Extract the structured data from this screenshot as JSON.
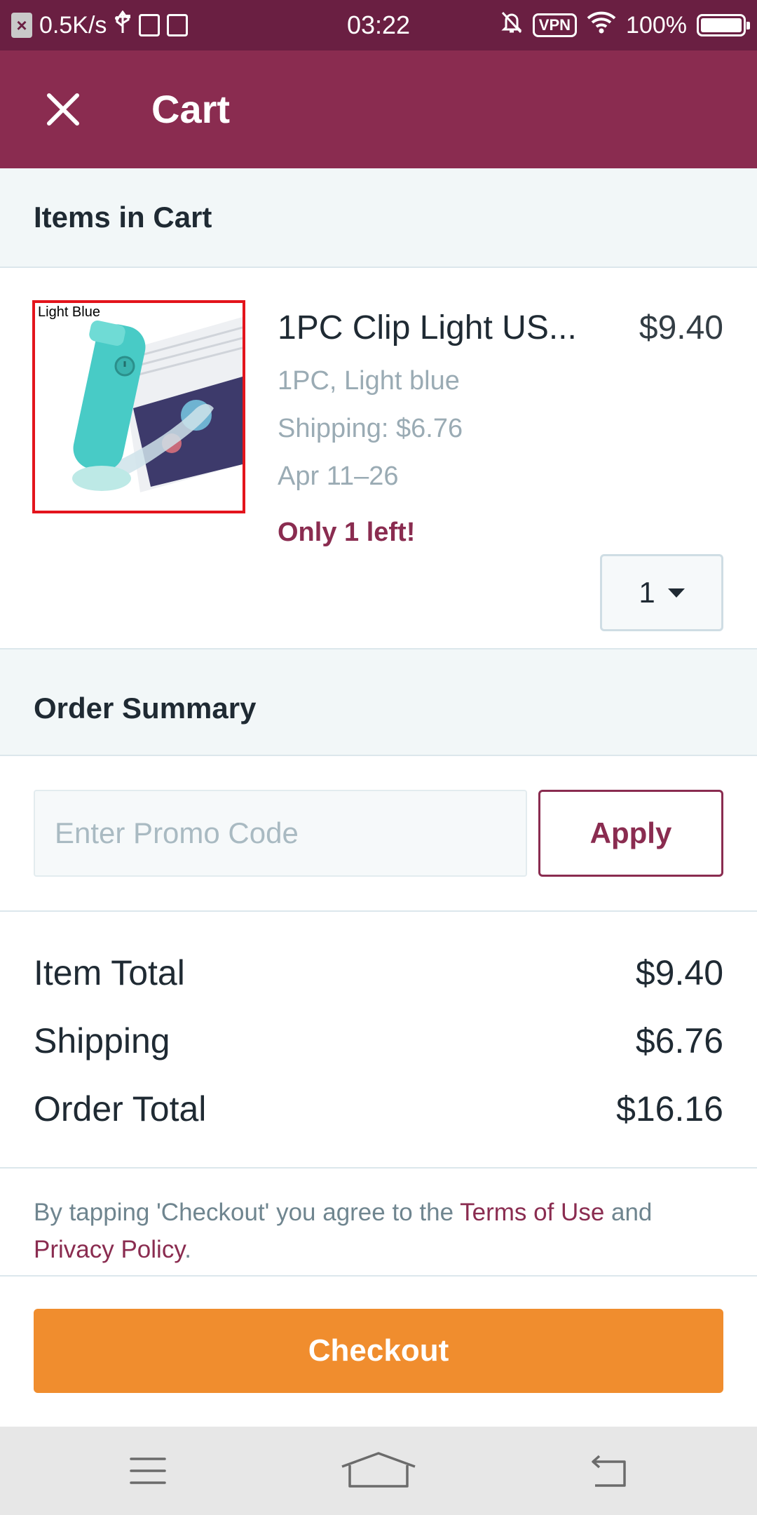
{
  "status_bar": {
    "speed": "0.5K/s",
    "time": "03:22",
    "vpn": "VPN",
    "battery": "100%"
  },
  "app_bar": {
    "title": "Cart"
  },
  "items_section": {
    "title": "Items in Cart"
  },
  "item": {
    "image_label": "Light Blue",
    "name": "1PC Clip Light US...",
    "price": "$9.40",
    "variant": "1PC, Light blue",
    "shipping": "Shipping: $6.76",
    "delivery": "Apr 11–26",
    "stock": "Only 1 left!",
    "quantity": "1"
  },
  "summary_section": {
    "title": "Order Summary"
  },
  "promo": {
    "placeholder": "Enter Promo Code",
    "apply_label": "Apply"
  },
  "totals": [
    {
      "label": "Item Total",
      "value": "$9.40"
    },
    {
      "label": "Shipping",
      "value": "$6.76"
    },
    {
      "label": "Order Total",
      "value": "$16.16"
    }
  ],
  "terms": {
    "prefix": "By tapping 'Checkout' you agree to the ",
    "terms_link": "Terms of Use",
    "middle": " and",
    "privacy_link": "Privacy Policy",
    "suffix": "."
  },
  "checkout": {
    "label": "Checkout"
  },
  "colors": {
    "status_bar": "#6a1f42",
    "app_bar": "#8a2c50",
    "accent": "#8a2c50",
    "checkout": "#f08d2e"
  },
  "icons": {
    "close": "close-icon",
    "quantity_dropdown": "chevron-down-icon",
    "nav_menu": "menu-icon",
    "nav_home": "home-icon",
    "nav_back": "back-icon"
  }
}
